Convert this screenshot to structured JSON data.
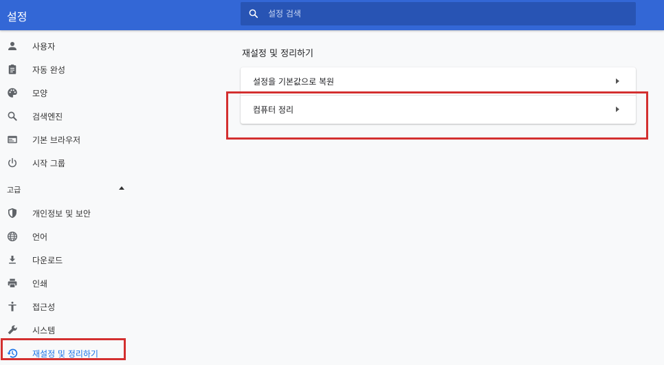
{
  "header": {
    "title": "설정"
  },
  "search": {
    "placeholder": "설정 검색"
  },
  "sidebar": {
    "items": [
      {
        "label": "사용자",
        "icon": "person-icon"
      },
      {
        "label": "자동 완성",
        "icon": "clipboard-icon"
      },
      {
        "label": "모양",
        "icon": "palette-icon"
      },
      {
        "label": "검색엔진",
        "icon": "search-icon"
      },
      {
        "label": "기본 브라우저",
        "icon": "browser-window-icon"
      },
      {
        "label": "시작 그룹",
        "icon": "power-icon"
      }
    ],
    "advanced_label": "고급",
    "advanced_items": [
      {
        "label": "개인정보 및 보안",
        "icon": "shield-icon"
      },
      {
        "label": "언어",
        "icon": "globe-icon"
      },
      {
        "label": "다운로드",
        "icon": "download-icon"
      },
      {
        "label": "인쇄",
        "icon": "printer-icon"
      },
      {
        "label": "접근성",
        "icon": "accessibility-icon"
      },
      {
        "label": "시스템",
        "icon": "wrench-icon"
      },
      {
        "label": "재설정 및 정리하기",
        "icon": "restore-history-icon"
      }
    ]
  },
  "main": {
    "section_title": "재설정 및 정리하기",
    "rows": [
      {
        "label": "설정을 기본값으로 복원"
      },
      {
        "label": "컴퓨터 정리"
      }
    ]
  },
  "colors": {
    "header_bg": "#3367d6",
    "search_bg": "#2854b4",
    "active_blue": "#1a73e8",
    "highlight_red": "#d32f2f",
    "icon_gray": "#5f6368"
  }
}
